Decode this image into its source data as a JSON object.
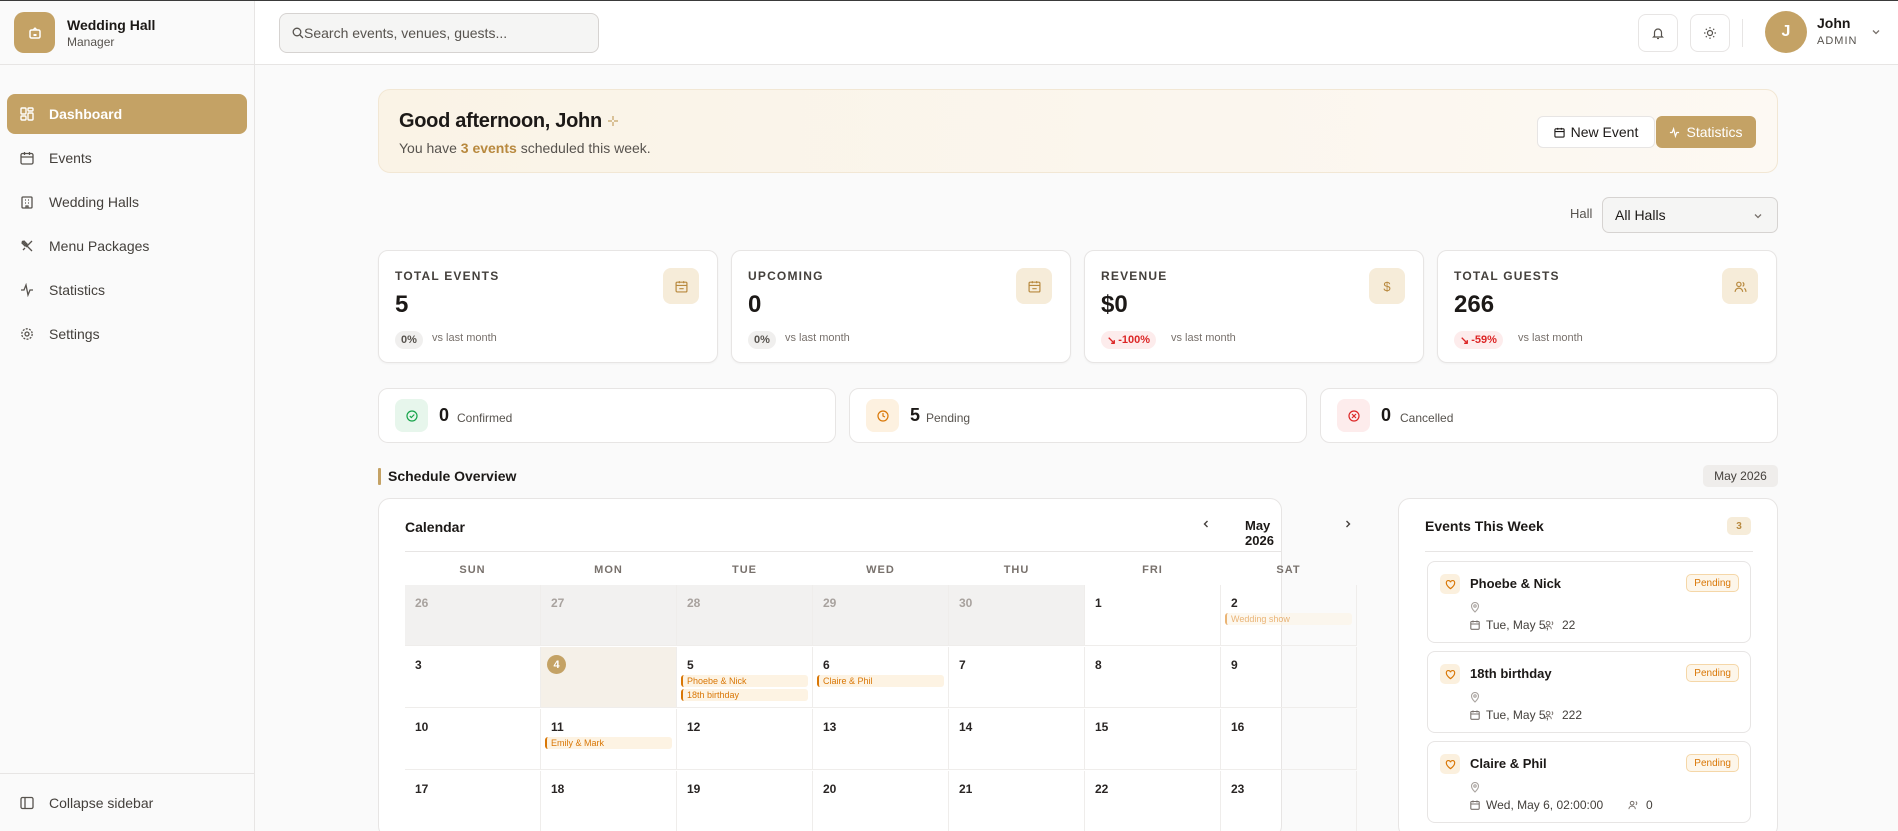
{
  "app": {
    "title": "Wedding Hall",
    "subtitle": "Manager"
  },
  "sidebar": {
    "items": [
      {
        "label": "Dashboard",
        "icon": "dashboard-icon",
        "active": true
      },
      {
        "label": "Events",
        "icon": "calendar-icon"
      },
      {
        "label": "Wedding Halls",
        "icon": "building-icon"
      },
      {
        "label": "Menu Packages",
        "icon": "utensils-icon"
      },
      {
        "label": "Statistics",
        "icon": "activity-icon"
      },
      {
        "label": "Settings",
        "icon": "gear-icon"
      }
    ],
    "collapse_label": "Collapse sidebar"
  },
  "header": {
    "search_placeholder": "Search events, venues, guests...",
    "user": {
      "initial": "J",
      "name": "John",
      "role": "ADMIN"
    }
  },
  "welcome": {
    "greeting": "Good afternoon, John",
    "sub_prefix": "You have ",
    "sub_highlight": "3 events",
    "sub_suffix": " scheduled this week.",
    "new_event_label": "New Event",
    "statistics_label": "Statistics"
  },
  "hall_filter": {
    "label": "Hall",
    "value": "All Halls"
  },
  "stats": [
    {
      "label": "TOTAL EVENTS",
      "value": "5",
      "change": "0%",
      "vs": "vs last month",
      "icon": "calendar-icon"
    },
    {
      "label": "UPCOMING",
      "value": "0",
      "change": "0%",
      "vs": "vs last month",
      "icon": "calendar-icon"
    },
    {
      "label": "REVENUE",
      "value": "$0",
      "change": "-100%",
      "vs": "vs last month",
      "icon": "dollar-icon"
    },
    {
      "label": "TOTAL GUESTS",
      "value": "266",
      "change": "-59%",
      "vs": "vs last month",
      "icon": "users-icon"
    }
  ],
  "status_counts": [
    {
      "count": "0",
      "label": "Confirmed",
      "color": "#16a34a"
    },
    {
      "count": "5",
      "label": "Pending",
      "color": "#d97706"
    },
    {
      "count": "0",
      "label": "Cancelled",
      "color": "#dc2626"
    }
  ],
  "schedule": {
    "title": "Schedule Overview",
    "month_badge": "May 2026",
    "calendar_title": "Calendar",
    "calendar_month": "May 2026",
    "weekdays": [
      "SUN",
      "MON",
      "TUE",
      "WED",
      "THU",
      "FRI",
      "SAT"
    ],
    "weeks": [
      [
        {
          "d": "26",
          "out": true
        },
        {
          "d": "27",
          "out": true
        },
        {
          "d": "28",
          "out": true
        },
        {
          "d": "29",
          "out": true
        },
        {
          "d": "30",
          "out": true
        },
        {
          "d": "1"
        },
        {
          "d": "2",
          "events": [
            "Wedding show"
          ],
          "faded": true
        }
      ],
      [
        {
          "d": "3"
        },
        {
          "d": "4",
          "today": true
        },
        {
          "d": "5",
          "events": [
            "Phoebe & Nick",
            "18th birthday"
          ]
        },
        {
          "d": "6",
          "events": [
            "Claire & Phil"
          ]
        },
        {
          "d": "7"
        },
        {
          "d": "8"
        },
        {
          "d": "9"
        }
      ],
      [
        {
          "d": "10"
        },
        {
          "d": "11",
          "events": [
            "Emily & Mark"
          ]
        },
        {
          "d": "12"
        },
        {
          "d": "13"
        },
        {
          "d": "14"
        },
        {
          "d": "15"
        },
        {
          "d": "16"
        }
      ],
      [
        {
          "d": "17"
        },
        {
          "d": "18"
        },
        {
          "d": "19"
        },
        {
          "d": "20"
        },
        {
          "d": "21"
        },
        {
          "d": "22"
        },
        {
          "d": "23"
        }
      ]
    ]
  },
  "week_events": {
    "title": "Events This Week",
    "count": "3",
    "items": [
      {
        "name": "Phoebe & Nick",
        "status": "Pending",
        "date": "Tue, May 5,",
        "guests": "22"
      },
      {
        "name": "18th birthday",
        "status": "Pending",
        "date": "Tue, May 5,",
        "guests": "222"
      },
      {
        "name": "Claire & Phil",
        "status": "Pending",
        "date": "Wed, May 6, 02:00:00",
        "guests": "0"
      }
    ]
  },
  "colors": {
    "accent": "#c4a265",
    "pending": "#d97706",
    "negative": "#dc2626"
  }
}
